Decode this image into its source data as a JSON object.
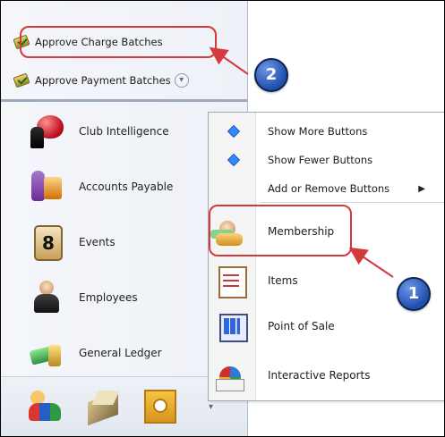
{
  "quick_items": [
    {
      "label": "Approve Charge Batches",
      "icon": "approve-charge-icon"
    },
    {
      "label": "Approve Payment Batches",
      "icon": "approve-payment-icon",
      "more_button_glyph": "▾"
    }
  ],
  "modules": [
    {
      "label": "Club Intelligence",
      "icon": "club-intelligence-icon"
    },
    {
      "label": "Accounts Payable",
      "icon": "accounts-payable-icon"
    },
    {
      "label": "Events",
      "icon": "events-icon"
    },
    {
      "label": "Employees",
      "icon": "employees-icon"
    },
    {
      "label": "General Ledger",
      "icon": "general-ledger-icon"
    }
  ],
  "bottom_bar": {
    "icons": [
      "people-icon",
      "box-icon",
      "report-icon"
    ],
    "overflow_glyph": "▾"
  },
  "menu": {
    "options": [
      {
        "label": "Show More Buttons",
        "icon": "show-more-icon"
      },
      {
        "label": "Show Fewer Buttons",
        "icon": "show-fewer-icon"
      },
      {
        "label": "Add or Remove Buttons",
        "icon": "add-remove-icon",
        "submenu_glyph": "▶"
      }
    ],
    "modules": [
      {
        "label": "Membership",
        "icon": "membership-icon"
      },
      {
        "label": "Items",
        "icon": "items-icon"
      },
      {
        "label": "Point of Sale",
        "icon": "point-of-sale-icon"
      },
      {
        "label": "Interactive Reports",
        "icon": "interactive-reports-icon"
      }
    ]
  },
  "annotations": {
    "callout_1": "1",
    "callout_2": "2",
    "highlight_color": "#d4393d",
    "callout_color": "#1f4eac"
  }
}
